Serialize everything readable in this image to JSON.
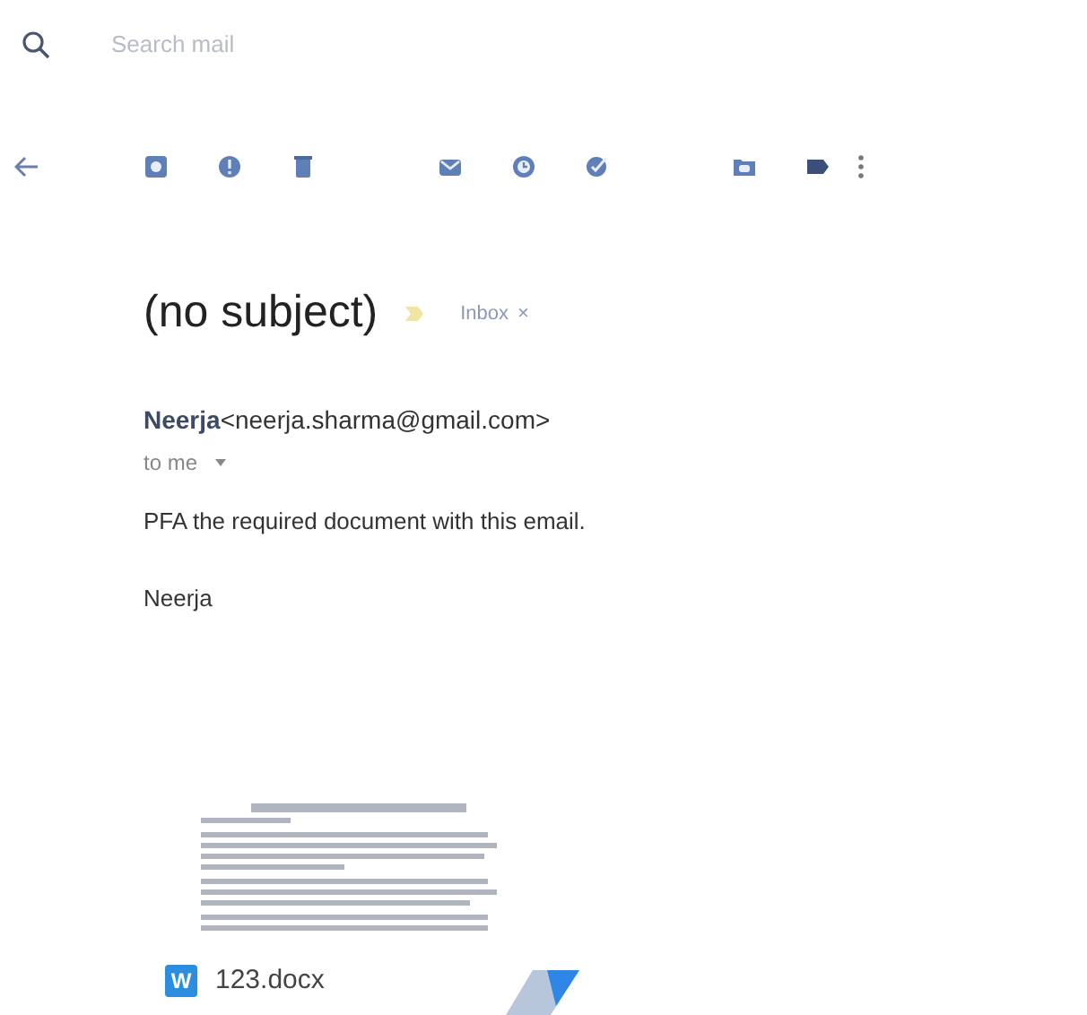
{
  "search": {
    "placeholder": "Search mail"
  },
  "subject": "(no subject)",
  "label": {
    "text": "Inbox",
    "remove": "×"
  },
  "sender": {
    "name": "Neerja",
    "email": "<neerja.sharma@gmail.com>"
  },
  "recipient": "to me",
  "body": [
    "PFA the required document with this email.",
    "Neerja"
  ],
  "attachment": {
    "badge": "W",
    "filename": "123.docx"
  }
}
